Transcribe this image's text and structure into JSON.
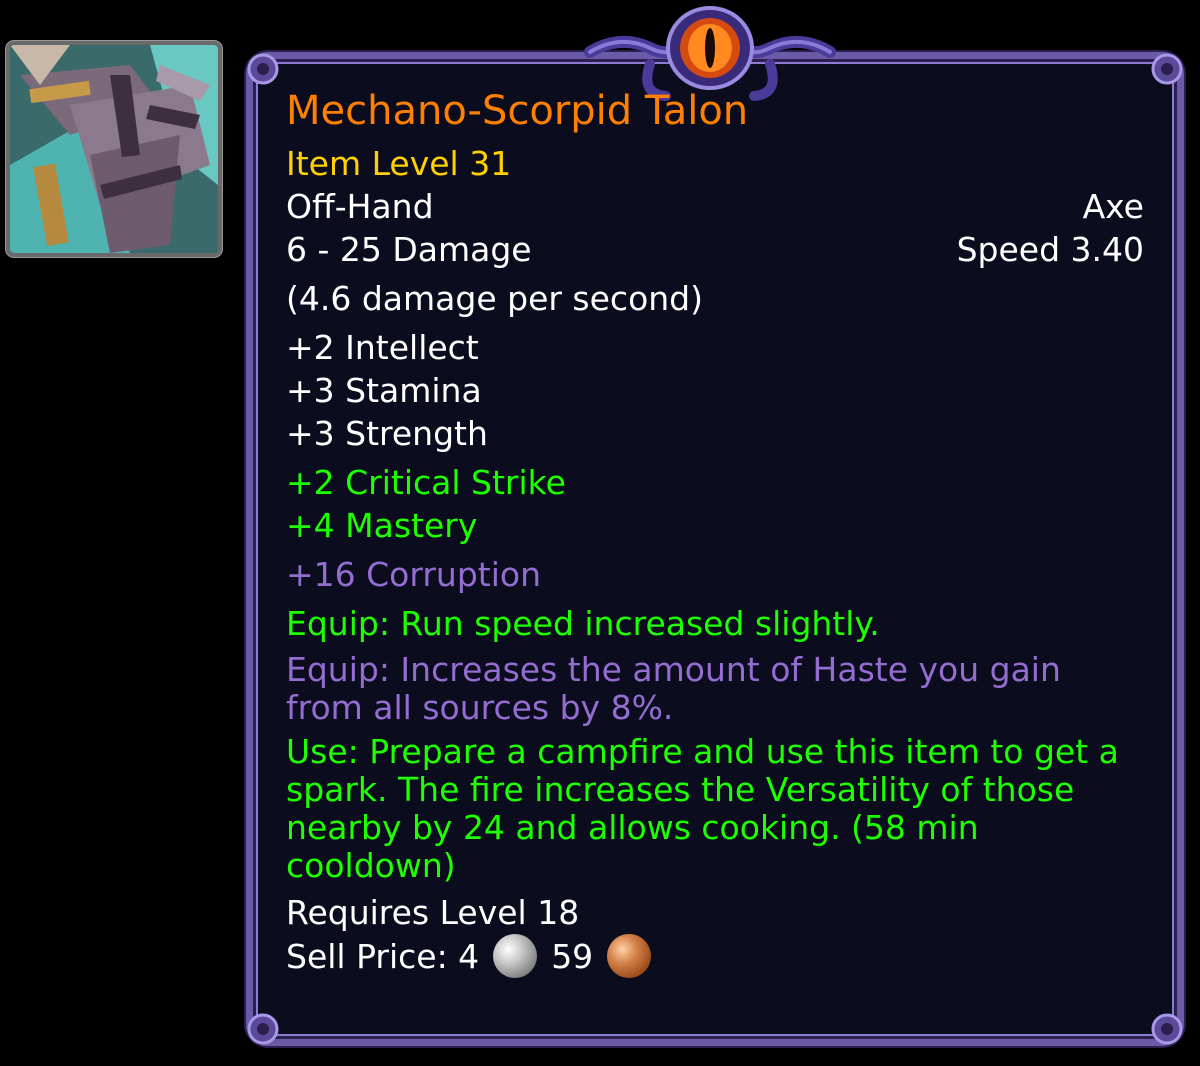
{
  "item": {
    "icon": "mechano-scorpid-talon-icon",
    "name": "Mechano-Scorpid Talon",
    "item_level": "Item Level 31",
    "slot": "Off-Hand",
    "type": "Axe",
    "damage": "6 - 25 Damage",
    "speed": "Speed 3.40",
    "dps": "(4.6 damage per second)",
    "primary_stats": [
      "+2 Intellect",
      "+3 Stamina",
      "+3 Strength"
    ],
    "secondary_stats": [
      "+2 Critical Strike",
      "+4 Mastery"
    ],
    "corruption": "+16 Corruption",
    "equip_effect": "Equip: Run speed increased slightly.",
    "corruption_effect": "Equip: Increases the amount of Haste you gain from all sources by 8%.",
    "use_effect": "Use: Prepare a campfire and use this item to get a spark. The fire increases the Versatility of those nearby by 24 and allows cooking. (58 min cooldown)",
    "requires": "Requires Level 18",
    "sell_label": "Sell Price: 4",
    "sell_silver_icon": "silver-coin-icon",
    "sell_copper": "59",
    "sell_copper_icon": "copper-coin-icon"
  },
  "colors": {
    "legendary_orange": "#ff8000",
    "item_level_yellow": "#ffd100",
    "stat_green": "#1eff00",
    "corruption_purple": "#946dd1",
    "frame_purple": "#6a5aa8",
    "background": "#0c0c1f"
  }
}
